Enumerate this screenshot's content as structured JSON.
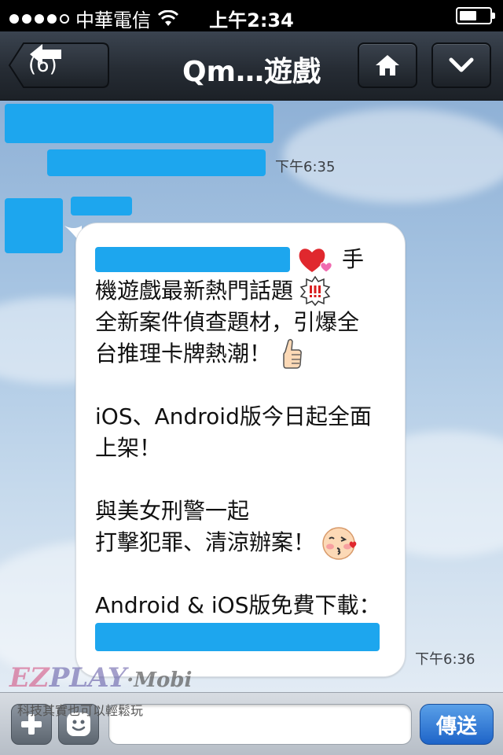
{
  "status_bar": {
    "carrier": "中華電信",
    "time": "上午2:34",
    "signal_bars": 4,
    "signal_max": 5,
    "battery_level": 0.55
  },
  "nav": {
    "unread_count": "(6)",
    "title": "Qm…遊戲",
    "icons": {
      "back": "back-arrow-icon",
      "home": "home-icon",
      "menu": "chevron-down-icon"
    }
  },
  "chat": {
    "messages": [
      {
        "sender": "redacted",
        "time": "下午6:35"
      },
      {
        "sender": "redacted",
        "time": "下午6:36",
        "lines": [
          "手",
          "機遊戲最新熱門話題",
          "全新案件偵查題材，引爆全",
          "台推理卡牌熱潮！",
          "",
          "iOS、Android版今日起全面",
          "上架！",
          "",
          "與美女刑警一起",
          "打擊犯罪、清涼辦案！",
          "",
          "Android & iOS版免費下載："
        ],
        "emojis": [
          "hearts-emoji",
          "exclamation-badge-emoji",
          "thumbs-up-emoji",
          "kissing-face-emoji"
        ]
      }
    ]
  },
  "watermark": {
    "brand_ez": "EZ",
    "brand_play": "PLAY",
    "brand_mobi": "·Mobi",
    "tagline": "科技其實也可以輕鬆玩"
  },
  "input_bar": {
    "placeholder": "",
    "send_label": "傳送",
    "icons": {
      "plus": "plus-icon",
      "emoji": "smiley-icon"
    }
  },
  "colors": {
    "accent_blue": "#1e64c8",
    "nav_dark": "#262c34",
    "redaction": "#1da6ee"
  }
}
